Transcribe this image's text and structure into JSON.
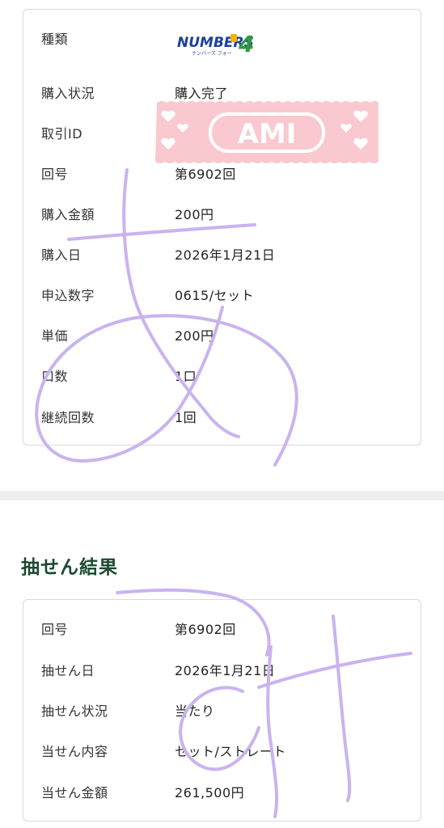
{
  "purchase": {
    "rows": [
      {
        "label": "種類",
        "value": ""
      },
      {
        "label": "購入状況",
        "value": "購入完了"
      },
      {
        "label": "取引ID",
        "value": ""
      },
      {
        "label": "回号",
        "value": "第6902回"
      },
      {
        "label": "購入金額",
        "value": "200円"
      },
      {
        "label": "購入日",
        "value": "2026年1月21日"
      },
      {
        "label": "申込数字",
        "value": "0615/セット"
      },
      {
        "label": "単価",
        "value": "200円"
      },
      {
        "label": "口数",
        "value": "1口"
      },
      {
        "label": "継続回数",
        "value": "1回"
      }
    ],
    "logo": {
      "main": "NUMBERS",
      "digit": "4",
      "kana": "ナンバーズ フォー"
    },
    "sticker_text": "AMI"
  },
  "result": {
    "title": "抽せん結果",
    "rows": [
      {
        "label": "回号",
        "value": "第6902回"
      },
      {
        "label": "抽せん日",
        "value": "2026年1月21日"
      },
      {
        "label": "抽せん状況",
        "value": "当たり"
      },
      {
        "label": "当せん内容",
        "value": "セット/ストレート"
      },
      {
        "label": "当せん金額",
        "value": "261,500円"
      }
    ]
  },
  "colors": {
    "heading_green": "#1c4a33",
    "card_border": "#d9d9d9",
    "scribble_purple": "#c9b3ef",
    "sticker_pink": "#f9c9cf",
    "logo_blue": "#1e3f9a",
    "logo_green": "#2e9a3c",
    "logo_yellow": "#f2b400"
  }
}
